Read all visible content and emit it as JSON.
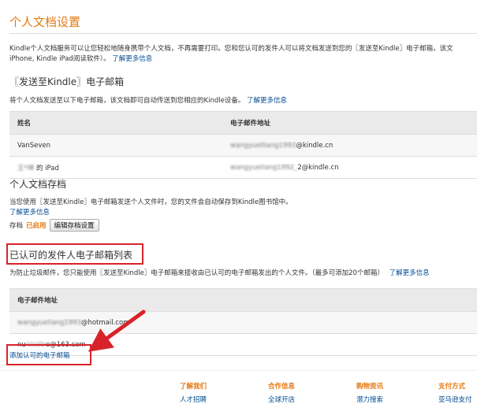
{
  "page": {
    "title": "个人文档设置",
    "intro_text": "Kindle个人文档服务可以让您轻松地随身携带个人文档，不再需要打印。您和您认可的发件人可以将文档发送到您的〖发送至Kindle〗电子邮箱，该文",
    "intro_text2": "iPhone, Kindle iPad阅读软件）。",
    "intro_link": "了解更多信息"
  },
  "send_to_kindle": {
    "title": "〖发送至Kindle〗电子邮箱",
    "description": "将个人文档发送至以下电子邮箱，该文档即可自动传送到您相应的Kindle设备。",
    "link": "了解更多信息",
    "columns": [
      "姓名",
      "电子邮件地址"
    ],
    "rows": [
      {
        "name": "VanSeven",
        "email_hidden": "wangyuelliang1993",
        "email_visible": "@kindle.cn"
      },
      {
        "name_hidden": "王*坤",
        "name_visible": "的 iPad",
        "email_hidden": "wangyueliang1992_",
        "email_visible": "2@kindle.cn"
      }
    ]
  },
  "archive": {
    "title": "个人文档存档",
    "description": "当您使用〖发送至Kindle〗电子邮箱发送个人文件时，您的文件会自动保存到Kindle图书馆中。",
    "link": "了解更多信息",
    "status_label": "存档",
    "status_value": "已启用",
    "edit_button": "编辑存档设置"
  },
  "approved_list": {
    "title": "已认可的发件人电子邮箱列表",
    "description": "为防止垃圾邮件，您只能使用〖发送至Kindle〗电子邮箱来接收由已认可的电子邮箱发出的个人文件。（最多可添加20个邮箱）",
    "link": "了解更多信息",
    "column": "电子邮件地址",
    "rows": [
      {
        "email_hidden": "wangyueliang1993",
        "email_visible": "@hotmail.com"
      },
      {
        "email_hidden_prefix": "nu",
        "email_hidden": "nicole",
        "email_visible": "e@163.com"
      }
    ],
    "add_link": "添加认可的电子邮箱"
  },
  "footer": {
    "columns": [
      {
        "head": "了解我们",
        "item": "人才招聘"
      },
      {
        "head": "合作信息",
        "item": "全球开店"
      },
      {
        "head": "购物资讯",
        "item": "潜力搜索"
      },
      {
        "head": "支付方式",
        "item": "亚马逊支付"
      }
    ]
  },
  "colors": {
    "accent": "#e47911",
    "link": "#004b91",
    "annotation": "#d8232a"
  }
}
